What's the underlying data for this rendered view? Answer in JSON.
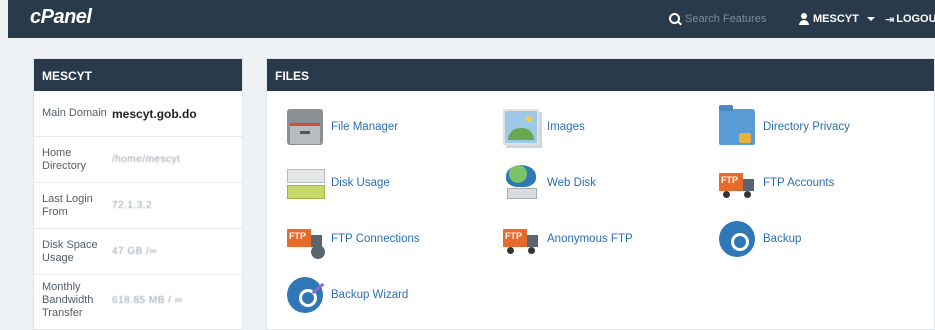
{
  "topbar": {
    "logo": "cPanel",
    "search_placeholder": "Search Features",
    "user_label": "MESCYT",
    "logout_label": "LOGOUT"
  },
  "stats": {
    "title": "MESCYT",
    "rows": [
      {
        "label": "Main Domain",
        "value": "mescyt.gob.do"
      },
      {
        "label": "Home Directory",
        "value": "/home/mescyt"
      },
      {
        "label": "Last Login From",
        "value": "72.1.3.2"
      },
      {
        "label": "Disk Space Usage",
        "value": "47 GB /∞"
      },
      {
        "label": "Monthly Bandwidth Transfer",
        "value": "618.85 MB / ∞"
      }
    ]
  },
  "files": {
    "title": "FILES",
    "tools": [
      {
        "label": "File Manager",
        "icon": "file-manager-icon"
      },
      {
        "label": "Images",
        "icon": "images-icon"
      },
      {
        "label": "Directory Privacy",
        "icon": "directory-privacy-icon"
      },
      {
        "label": "Disk Usage",
        "icon": "disk-usage-icon"
      },
      {
        "label": "Web Disk",
        "icon": "web-disk-icon"
      },
      {
        "label": "FTP Accounts",
        "icon": "ftp-accounts-icon"
      },
      {
        "label": "FTP Connections",
        "icon": "ftp-connections-icon"
      },
      {
        "label": "Anonymous FTP",
        "icon": "anonymous-ftp-icon"
      },
      {
        "label": "Backup",
        "icon": "backup-icon"
      },
      {
        "label": "Backup Wizard",
        "icon": "backup-wizard-icon"
      }
    ]
  },
  "ftp_badge": "FTP"
}
